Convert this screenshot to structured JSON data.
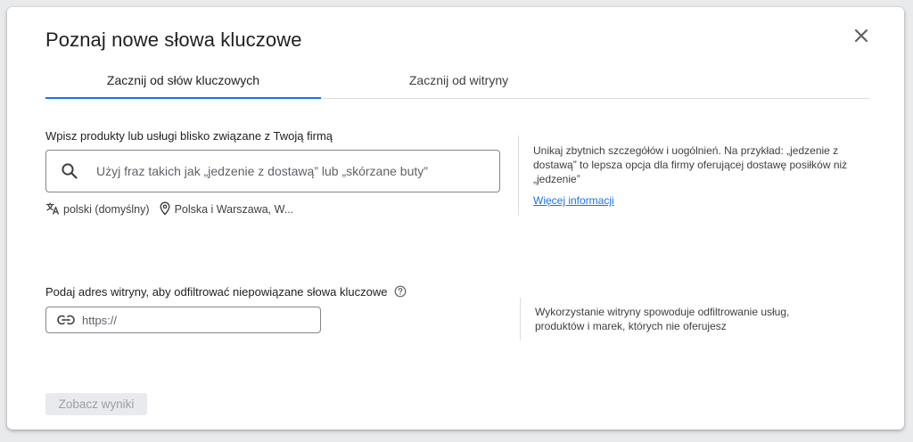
{
  "dialog": {
    "title": "Poznaj nowe słowa kluczowe"
  },
  "tabs": [
    {
      "label": "Zacznij od słów kluczowych",
      "active": true
    },
    {
      "label": "Zacznij od witryny",
      "active": false
    }
  ],
  "keywords_section": {
    "label": "Wpisz produkty lub usługi blisko związane z Twoją firmą",
    "search_placeholder": "Użyj fraz takich jak „jedzenie z dostawą” lub „skórzane buty”",
    "search_value": "",
    "language": "polski (domyślny)",
    "location": "Polska i Warszawa, W...",
    "hint": "Unikaj zbytnich szczegółów i uogólnień. Na przykład: „jedzenie z dostawą” to lepsza opcja dla firmy oferującej dostawę posiłków niż „jedzenie”",
    "more_info_link": "Więcej informacji"
  },
  "website_section": {
    "label": "Podaj adres witryny, aby odfiltrować niepowiązane słowa kluczowe",
    "url_placeholder": "https://",
    "url_value": "",
    "hint": "Wykorzystanie witryny spowoduje odfiltrowanie usług, produktów i marek, których nie oferujesz"
  },
  "actions": {
    "results_button": "Zobacz wyniki",
    "results_disabled": true
  },
  "colors": {
    "accent": "#1a73e8",
    "text": "#202124",
    "border": "#80868b",
    "disabled_bg": "#e8eaed",
    "disabled_text": "#9aa0a6"
  },
  "icons": {
    "close": "close-icon",
    "search": "search-icon",
    "language": "translate-icon",
    "location": "location-pin-icon",
    "help": "help-icon",
    "link": "link-icon"
  }
}
